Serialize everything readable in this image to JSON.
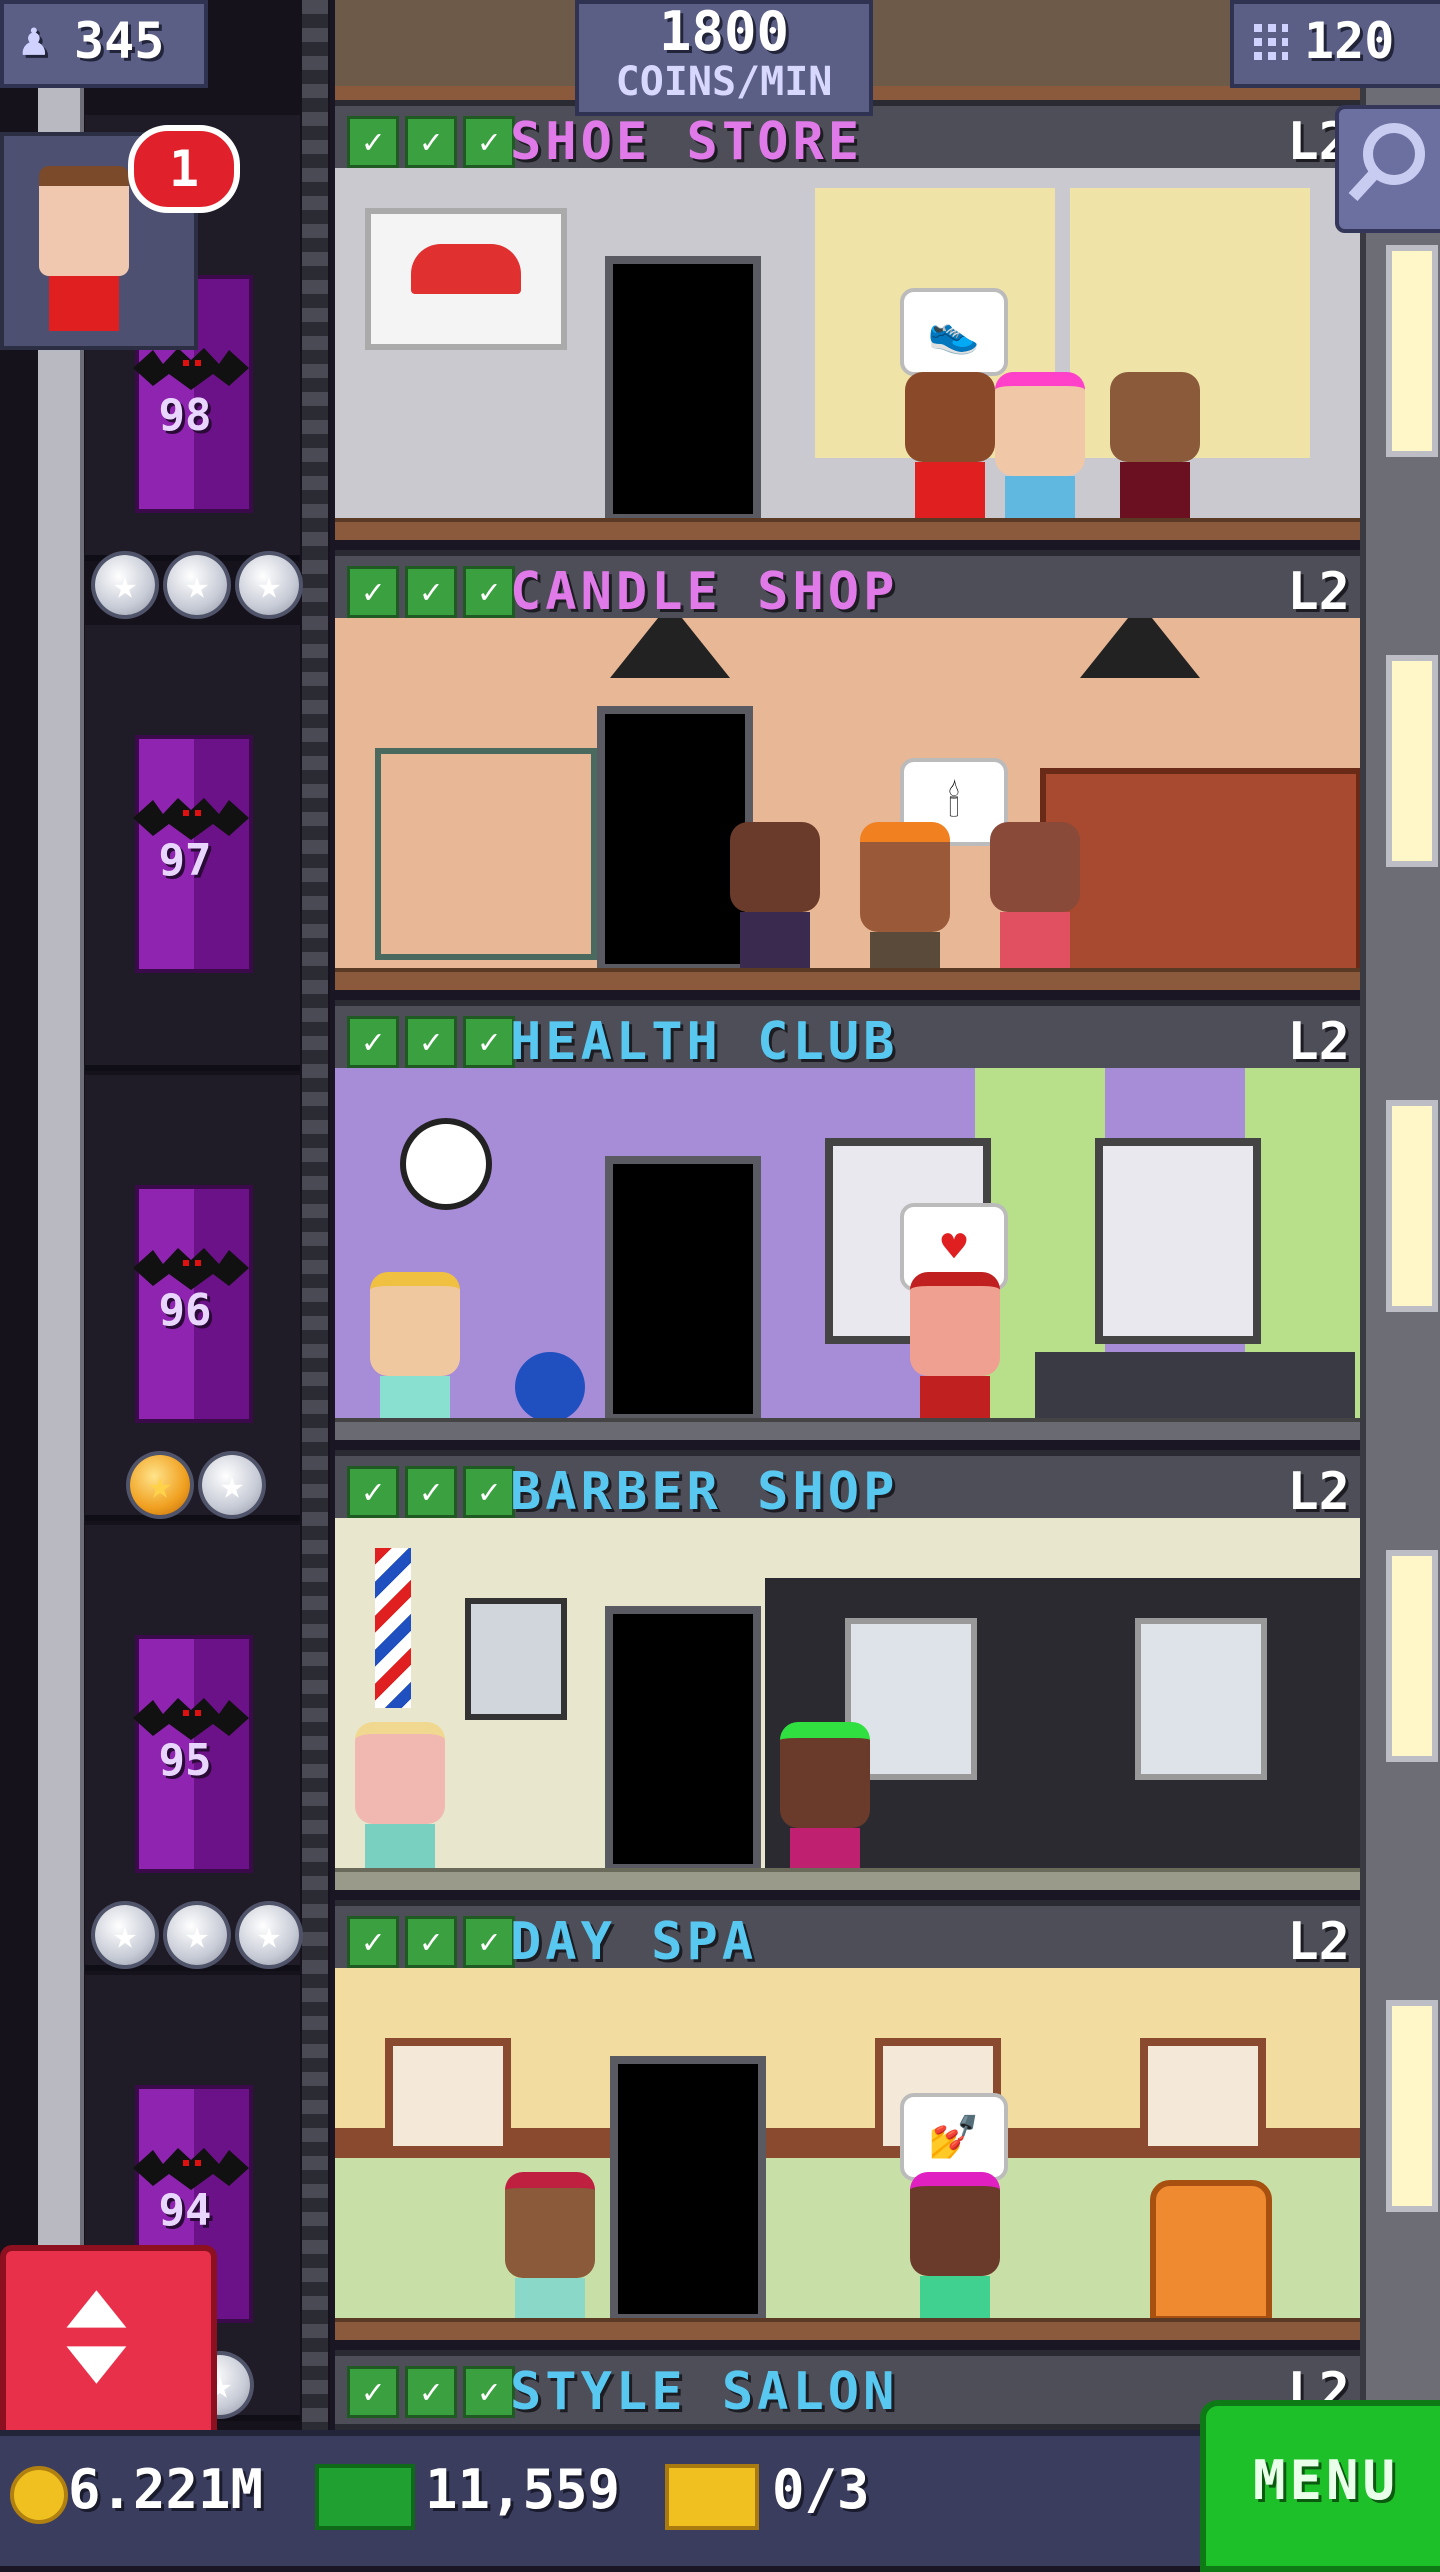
{
  "top_bar": {
    "population": "345",
    "coins_per_min_value": "1800",
    "coins_per_min_unit": "COINS/MIN",
    "floors_count": "120"
  },
  "notifications": {
    "badge_count": "1"
  },
  "elevator": {
    "floor_numbers": [
      "98",
      "97",
      "96",
      "95",
      "94"
    ]
  },
  "floors": [
    {
      "name": "SHOE STORE",
      "level": "L2",
      "name_color": "#e07ae8"
    },
    {
      "name": "CANDLE SHOP",
      "level": "L2",
      "name_color": "#e07ae8"
    },
    {
      "name": "HEALTH CLUB",
      "level": "L2",
      "name_color": "#58c8f0"
    },
    {
      "name": "BARBER SHOP",
      "level": "L2",
      "name_color": "#58c8f0"
    },
    {
      "name": "DAY SPA",
      "level": "L2",
      "name_color": "#58c8f0"
    },
    {
      "name": "STYLE SALON",
      "level": "L2",
      "name_color": "#58c8f0"
    }
  ],
  "bottom_bar": {
    "coins": "6.221M",
    "bux": "11,559",
    "tickets": "0/3",
    "menu_label": "MENU"
  },
  "colors": {
    "elevator_door": "#7a1a9a",
    "menu_button": "#1ec02a",
    "scroll_button": "#e8304a",
    "badge": "#e0202a"
  },
  "icons": {
    "population": "person-icon",
    "floors": "building-icon",
    "search": "magnifier-icon",
    "scroll": "up-down-arrows-icon",
    "coins": "coin-icon",
    "bux": "cash-icon",
    "tickets": "ticket-icon"
  }
}
